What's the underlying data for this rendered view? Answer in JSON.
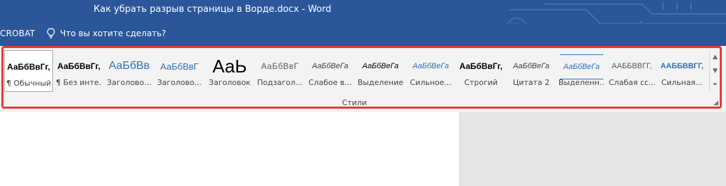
{
  "window": {
    "title": "Как убрать разрыв страницы в Ворде.docx - Word"
  },
  "tellbar": {
    "acrobat_label": "CROBAT",
    "tell_me_placeholder": "Что вы хотите сделать?"
  },
  "ribbon": {
    "group_label": "Стили",
    "styles": [
      {
        "sample": "АаБбВвГг,",
        "label": "¶ Обычный"
      },
      {
        "sample": "АаБбВвГг,",
        "label": "¶ Без инте..."
      },
      {
        "sample": "АаБбВв",
        "label": "Заголово..."
      },
      {
        "sample": "АаБбВвГ",
        "label": "Заголово..."
      },
      {
        "sample": "АаЬ",
        "label": "Заголовок"
      },
      {
        "sample": "АаБбВвГ",
        "label": "Подзагол..."
      },
      {
        "sample": "АаБбВеГа",
        "label": "Слабое в..."
      },
      {
        "sample": "АаБбВеГа",
        "label": "Выделение"
      },
      {
        "sample": "АаБбВеГа",
        "label": "Сильное..."
      },
      {
        "sample": "АаБбВвГг,",
        "label": "Строгий"
      },
      {
        "sample": "АаБбВеГа",
        "label": "Цитата 2"
      },
      {
        "sample": "АаБбВеГа",
        "label": "Выделенн..."
      },
      {
        "sample": "АаБбВвГг,",
        "label": "Слабая сс..."
      },
      {
        "sample": "АаБбВвГг,",
        "label": "Сильная..."
      }
    ]
  },
  "colors": {
    "title_bar": "#2b579a",
    "ribbon_bg": "#f3f3f3",
    "highlight_border": "#e53935",
    "heading_blue": "#2e74b5"
  },
  "icons": {
    "tell_me": "lightbulb-icon",
    "scroll_up": "chevron-up-icon",
    "scroll_down": "chevron-down-icon",
    "more": "more-styles-icon",
    "launcher": "dialog-launcher-icon"
  }
}
